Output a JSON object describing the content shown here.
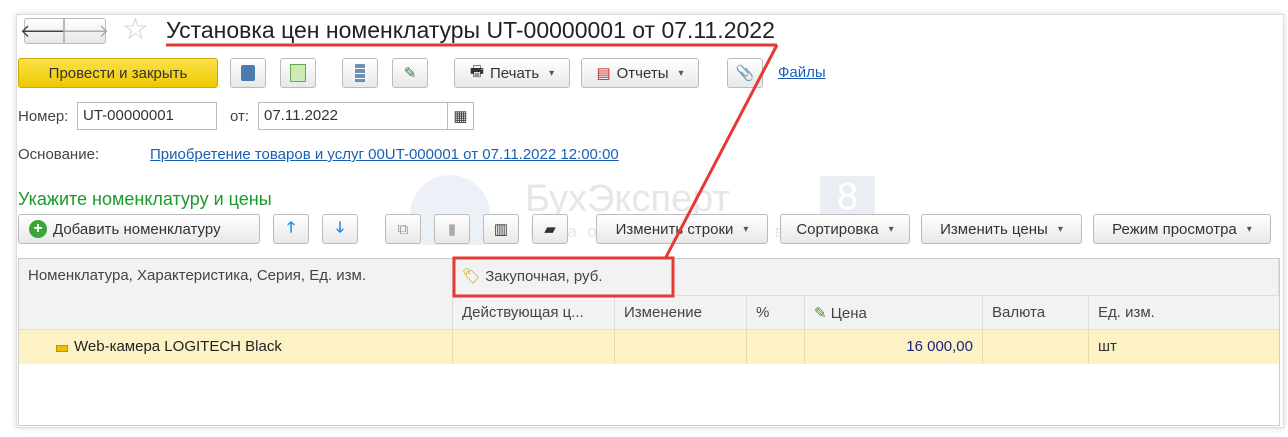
{
  "title": "Установка цен номенклатуры UT-00000001 от 07.11.2022",
  "toolbar": {
    "post_close": "Провести и закрыть",
    "print": "Печать",
    "reports": "Отчеты",
    "files": "Файлы"
  },
  "form": {
    "number_label": "Номер:",
    "number_value": "UT-00000001",
    "date_label": "от:",
    "date_value": "07.11.2022",
    "basis_label": "Основание:",
    "basis_link": "Приобретение товаров и услуг 00UT-000001 от 07.11.2022 12:00:00"
  },
  "section_title": "Укажите номенклатуру и цены",
  "table_toolbar": {
    "add": "Добавить номенклатуру",
    "change_rows": "Изменить строки",
    "sort": "Сортировка",
    "change_prices": "Изменить цены",
    "view_mode": "Режим просмотра"
  },
  "table": {
    "col_item": "Номенклатура, Характеристика, Серия, Ед. изм.",
    "group": "Закупочная, руб.",
    "cols": [
      "Действующая ц...",
      "Изменение",
      "%",
      "Цена",
      "Валюта",
      "Ед. изм."
    ],
    "rows": [
      {
        "item": "Web-камера LOGITECH Black",
        "current": "",
        "change": "",
        "percent": "",
        "price": "16 000,00",
        "currency": "",
        "unit": "шт"
      }
    ]
  },
  "watermark": {
    "brand": "БухЭксперт",
    "num": "8",
    "sub": "База ответов по учету в 1С"
  },
  "colors": {
    "accent_yellow": "#f5d40f",
    "highlight_red": "#e53935",
    "section_green": "#1a9a2a",
    "row_bg": "#fdf2c6"
  }
}
